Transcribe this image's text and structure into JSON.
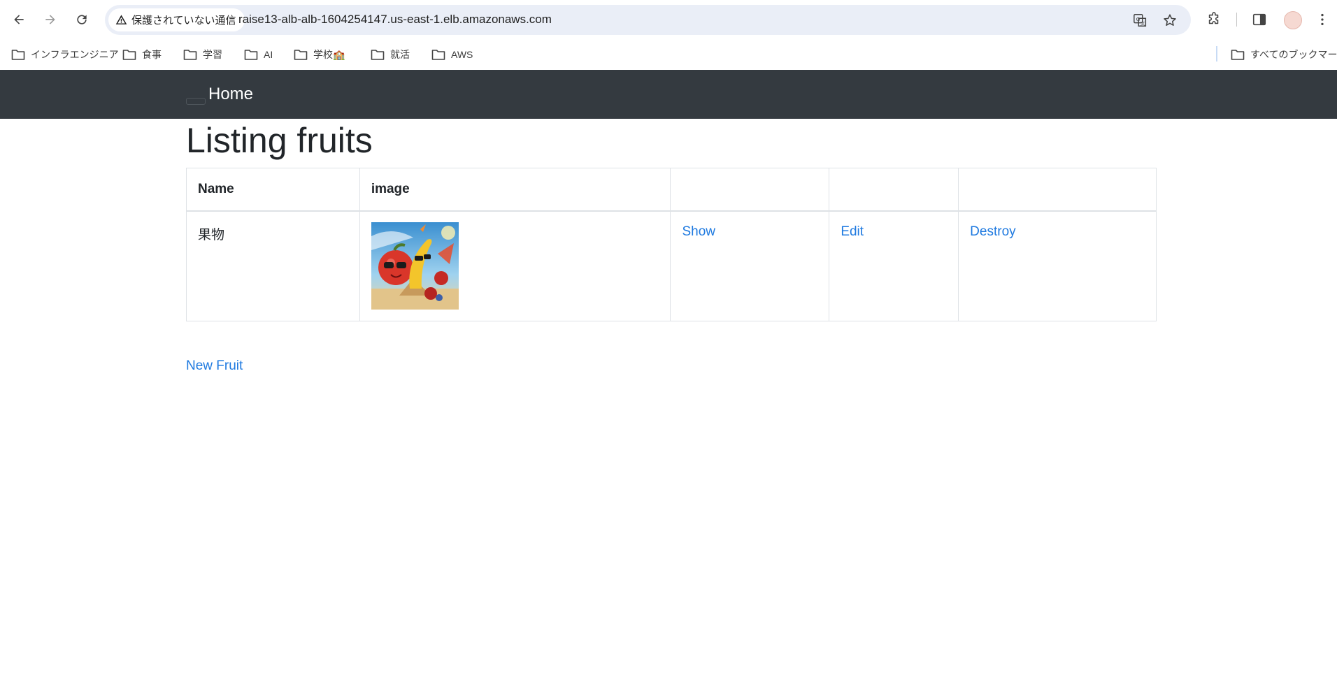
{
  "browser": {
    "security_label": "保護されていない通信",
    "url": "raise13-alb-alb-1604254147.us-east-1.elb.amazonaws.com",
    "bookmarks": [
      {
        "label": "インフラエンジニア"
      },
      {
        "label": "食事"
      },
      {
        "label": "学習"
      },
      {
        "label": "AI"
      },
      {
        "label": "学校🏫"
      },
      {
        "label": "就活"
      },
      {
        "label": "AWS"
      }
    ],
    "all_bookmarks_label": "すべてのブックマーク"
  },
  "navbar": {
    "brand": "Home"
  },
  "page": {
    "title": "Listing fruits",
    "table": {
      "headers": [
        "Name",
        "image",
        "",
        "",
        ""
      ],
      "rows": [
        {
          "name": "果物",
          "show": "Show",
          "edit": "Edit",
          "destroy": "Destroy"
        }
      ]
    },
    "new_link": "New Fruit"
  },
  "colors": {
    "navbar_bg": "#343a40",
    "link": "#1f7ae0",
    "omnibox_bg": "#eaeef7"
  }
}
